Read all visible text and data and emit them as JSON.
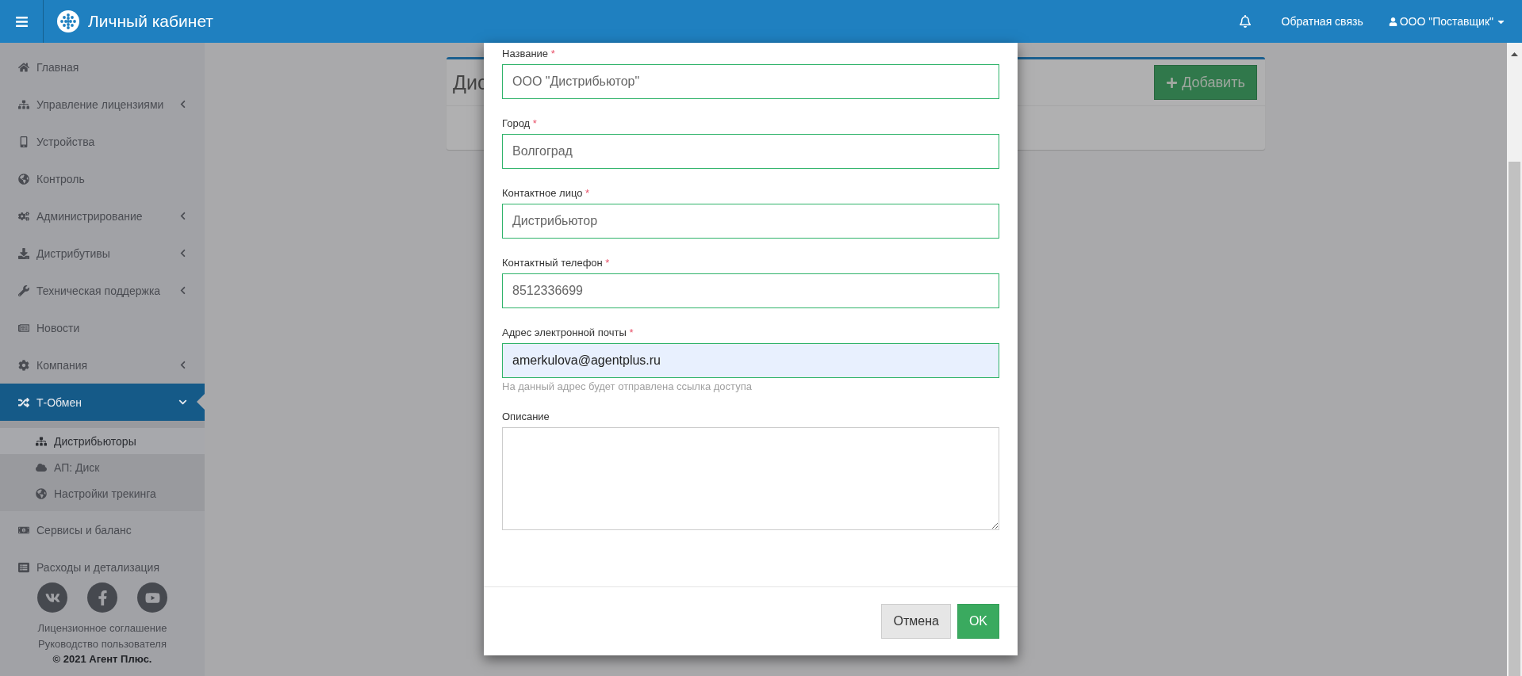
{
  "header": {
    "title": "Личный кабинет",
    "feedback_link": "Обратная связь",
    "user_menu": "ООО \"Поставщик\""
  },
  "sidebar": {
    "items": [
      {
        "label": "Главная",
        "selected": false
      },
      {
        "label": "Управление лицензиями",
        "selected": false,
        "expanded": false
      },
      {
        "label": "Устройства",
        "selected": false
      },
      {
        "label": "Контроль",
        "selected": false
      },
      {
        "label": "Администрирование",
        "selected": false,
        "expanded": false
      },
      {
        "label": "Дистрибутивы",
        "selected": false,
        "expanded": false
      },
      {
        "label": "Техническая поддержка",
        "selected": false,
        "expanded": false
      },
      {
        "label": "Новости",
        "selected": false
      },
      {
        "label": "Компания",
        "selected": false,
        "expanded": false
      },
      {
        "label": "Т-Обмен",
        "selected": true,
        "expanded": true,
        "children": [
          {
            "label": "Дистрибьюторы",
            "selected": true
          },
          {
            "label": "АП: Диск",
            "selected": false
          },
          {
            "label": "Настройки трекинга",
            "selected": false
          }
        ]
      },
      {
        "label": "Сервисы и баланс",
        "selected": false
      },
      {
        "label": "Расходы и детализация",
        "selected": false
      }
    ],
    "footer_links": [
      "Лицензионное соглашение",
      "Руководство пользователя"
    ],
    "copyright": "© 2021 Агент Плюс."
  },
  "card": {
    "title": "Дис",
    "add_button": "Добавить"
  },
  "modal": {
    "fields": [
      {
        "label": "Название",
        "required_mark": "*",
        "value": "ООО \"Дистрибьютор\"",
        "autofilled": false
      },
      {
        "label": "Город",
        "required_mark": "*",
        "value": "Волгоград",
        "autofilled": false
      },
      {
        "label": "Контактное лицо",
        "required_mark": "*",
        "value": "Дистрибьютор",
        "autofilled": false
      },
      {
        "label": "Контактный телефон",
        "required_mark": "*",
        "value": "8512336699",
        "autofilled": false
      },
      {
        "label": "Адрес электронной почты",
        "required_mark": "*",
        "value": "amerkulova@agentplus.ru",
        "autofilled": true,
        "help": "На данный адрес будет отправлена ссылка доступа"
      }
    ],
    "description": {
      "label": "Описание"
    },
    "buttons": [
      {
        "label": "Отмена",
        "kind": "secondary"
      },
      {
        "label": "OK",
        "kind": "primary"
      }
    ]
  }
}
